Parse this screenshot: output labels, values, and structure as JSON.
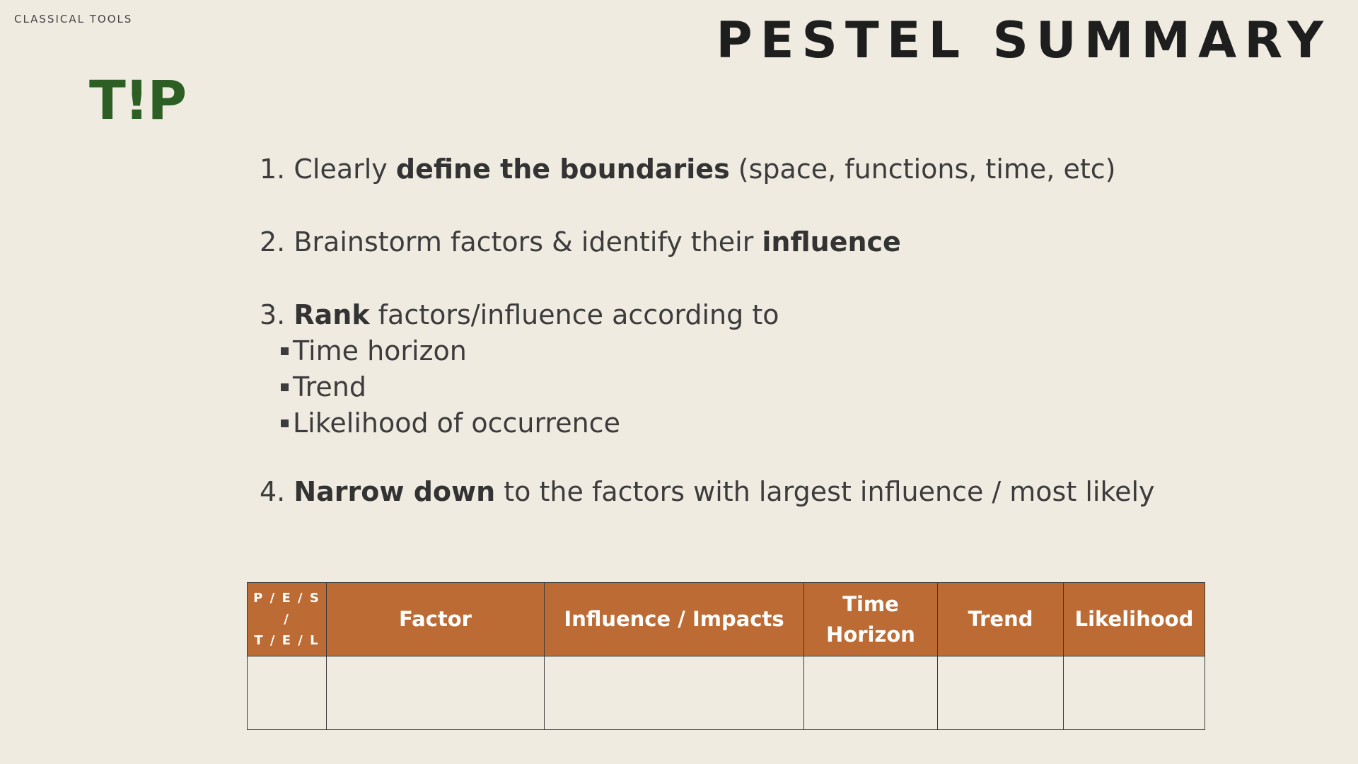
{
  "header": {
    "section_label": "CLASSICAL TOOLS",
    "title": "PESTEL SUMMARY"
  },
  "tip": {
    "logo_text": "T!P"
  },
  "steps": [
    {
      "number": "1.",
      "before": "Clearly ",
      "bold": "define the boundaries",
      "after": " (space, functions, time, etc)"
    },
    {
      "number": "2.",
      "before": "Brainstorm factors & identify their ",
      "bold": "influence",
      "after": ""
    },
    {
      "number": "3.",
      "before": "",
      "bold": "Rank",
      "after": " factors/influence according to",
      "subitems": [
        "Time horizon",
        "Trend",
        "Likelihood of occurrence"
      ]
    },
    {
      "number": "4.",
      "before": "",
      "bold": "Narrow down",
      "after": " to the factors with largest influence / most likely"
    }
  ],
  "table": {
    "headers": {
      "pestel_line1": "P / E / S /",
      "pestel_line2": "T / E / L",
      "factor": "Factor",
      "influence": "Influence / Impacts",
      "time_line1": "Time",
      "time_line2": "Horizon",
      "trend": "Trend",
      "likelihood": "Likelihood"
    }
  },
  "colors": {
    "background": "#efebe1",
    "table_header": "#bd6b34",
    "tip_green": "#2d5e23"
  }
}
